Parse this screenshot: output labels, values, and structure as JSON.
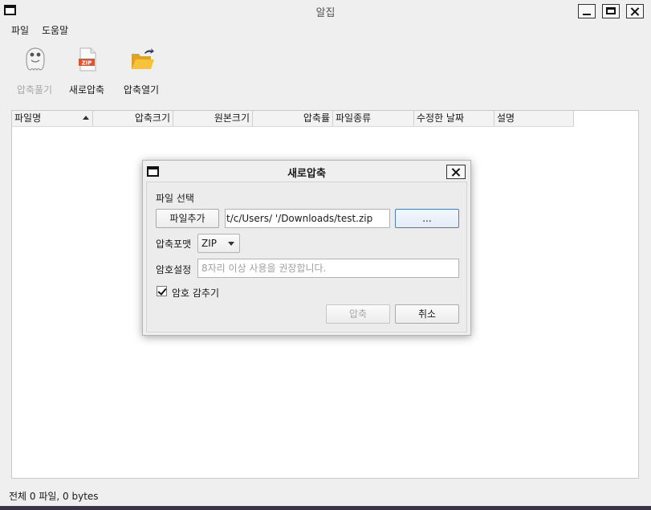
{
  "window": {
    "title": "알집"
  },
  "menu": {
    "file": "파일",
    "help": "도움말"
  },
  "toolbar": {
    "extract_label": "압축풀기",
    "new_archive_label": "새로압축",
    "open_archive_label": "압축열기"
  },
  "table": {
    "columns": [
      "파일명",
      "압축크기",
      "원본크기",
      "압축률",
      "파일종류",
      "수정한 날짜",
      "설명"
    ]
  },
  "status": {
    "text": "전체 0 파일, 0 bytes"
  },
  "dialog": {
    "title": "새로압축",
    "file_select_label": "파일 선택",
    "add_file_button": "파일추가",
    "path_value": "t/c/Users/        '/Downloads/test.zip",
    "browse_button": "...",
    "format_label": "압축포맷",
    "format_value": "ZIP",
    "password_label": "암호설정",
    "password_placeholder": "8자리 이상 사용을 권장합니다.",
    "hide_password_label": "암호 감추기",
    "hide_password_checked": true,
    "ok_button": "압축",
    "cancel_button": "취소"
  },
  "icons": {
    "extract": "ghost-icon",
    "new_archive": "zip-file-icon",
    "open_archive": "folder-open-icon"
  }
}
